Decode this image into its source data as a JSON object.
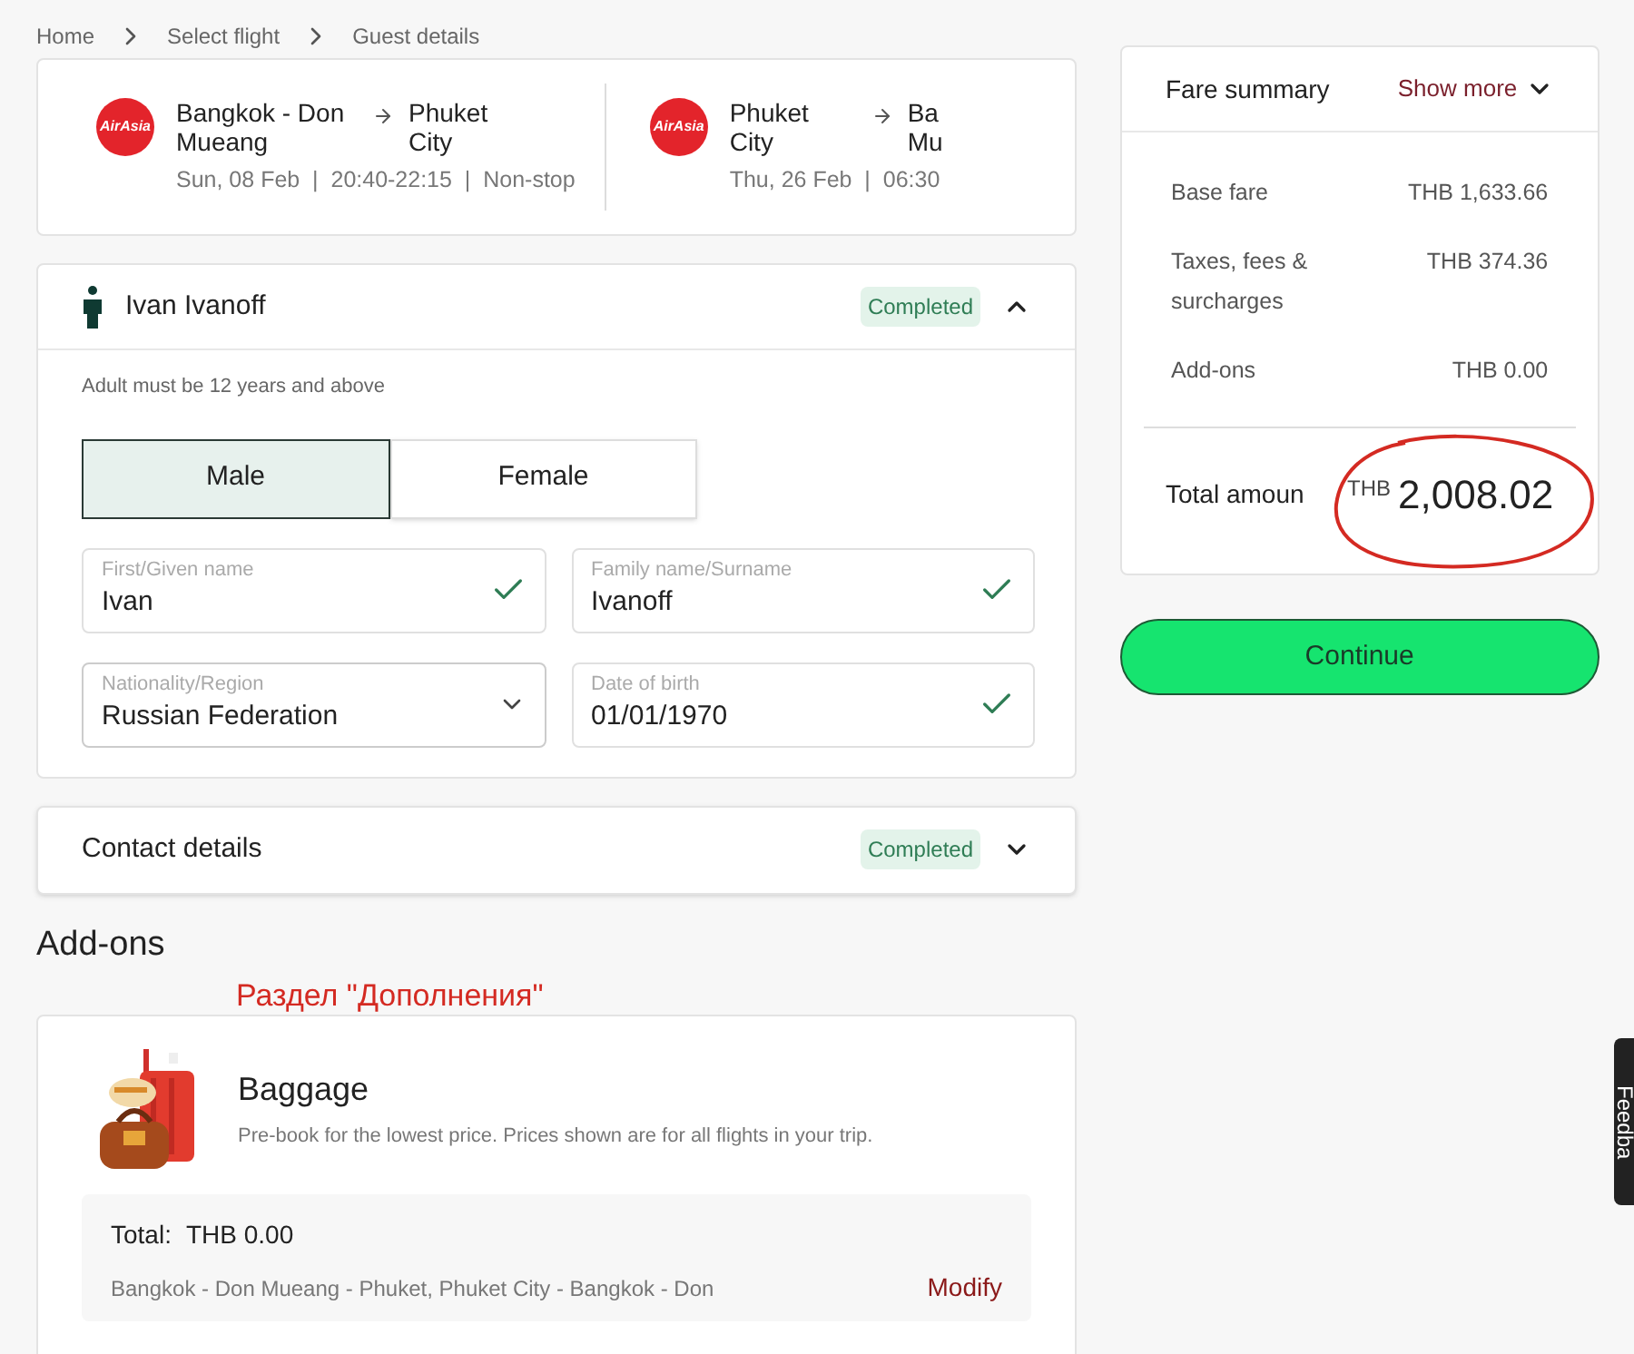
{
  "breadcrumbs": [
    {
      "label": "Home"
    },
    {
      "label": "Select flight"
    },
    {
      "label": "Guest details"
    }
  ],
  "flights": [
    {
      "logo_text": "AirAsia",
      "origin": "Bangkok - Don Mueang",
      "destination": "Phuket City",
      "schedule": "Sun, 08 Feb  |  20:40-22:15  |  Non-stop"
    },
    {
      "logo_text": "AirAsia",
      "origin": "Phuket City",
      "destination": "Ba Mu",
      "schedule": "Thu, 26 Feb  |  06:30"
    }
  ],
  "passenger": {
    "name": "Ivan Ivanoff",
    "status": "Completed",
    "expanded": true,
    "note": "Adult must be 12 years and above",
    "genders": [
      {
        "label": "Male",
        "selected": true
      },
      {
        "label": "Female",
        "selected": false
      }
    ],
    "fields": [
      {
        "kind": "text",
        "label": "First/Given name",
        "value": "Ivan",
        "valid": true
      },
      {
        "kind": "text",
        "label": "Family name/Surname",
        "value": "Ivanoff",
        "valid": true
      },
      {
        "kind": "select",
        "label": "Nationality/Region",
        "value": "Russian Federation"
      },
      {
        "kind": "text",
        "label": "Date of birth",
        "value": "01/01/1970",
        "valid": true
      }
    ]
  },
  "contact": {
    "title": "Contact details",
    "status": "Completed",
    "expanded": false
  },
  "addons": {
    "heading": "Add-ons",
    "annotation": "Раздел \"Дополнения\"",
    "baggage": {
      "title": "Baggage",
      "description": "Pre-book for the lowest price. Prices shown are for all flights in your trip.",
      "total_label": "Total:",
      "total_value": "THB 0.00",
      "route": "Bangkok - Don Mueang - Phuket, Phuket City - Bangkok - Don",
      "action": "Modify"
    }
  },
  "fare": {
    "title": "Fare summary",
    "toggle": "Show more",
    "rows": [
      {
        "label": "Base fare",
        "value": "THB 1,633.66"
      },
      {
        "label": "Taxes, fees & surcharges",
        "value": "THB 374.36"
      },
      {
        "label": "Add-ons",
        "value": "THB 0.00"
      }
    ],
    "total_label": "Total amoun",
    "total_currency": "THB",
    "total_value": "2,008.02",
    "circled": true
  },
  "continue": {
    "label": "Continue"
  },
  "feedback": {
    "label": "Feedba"
  }
}
